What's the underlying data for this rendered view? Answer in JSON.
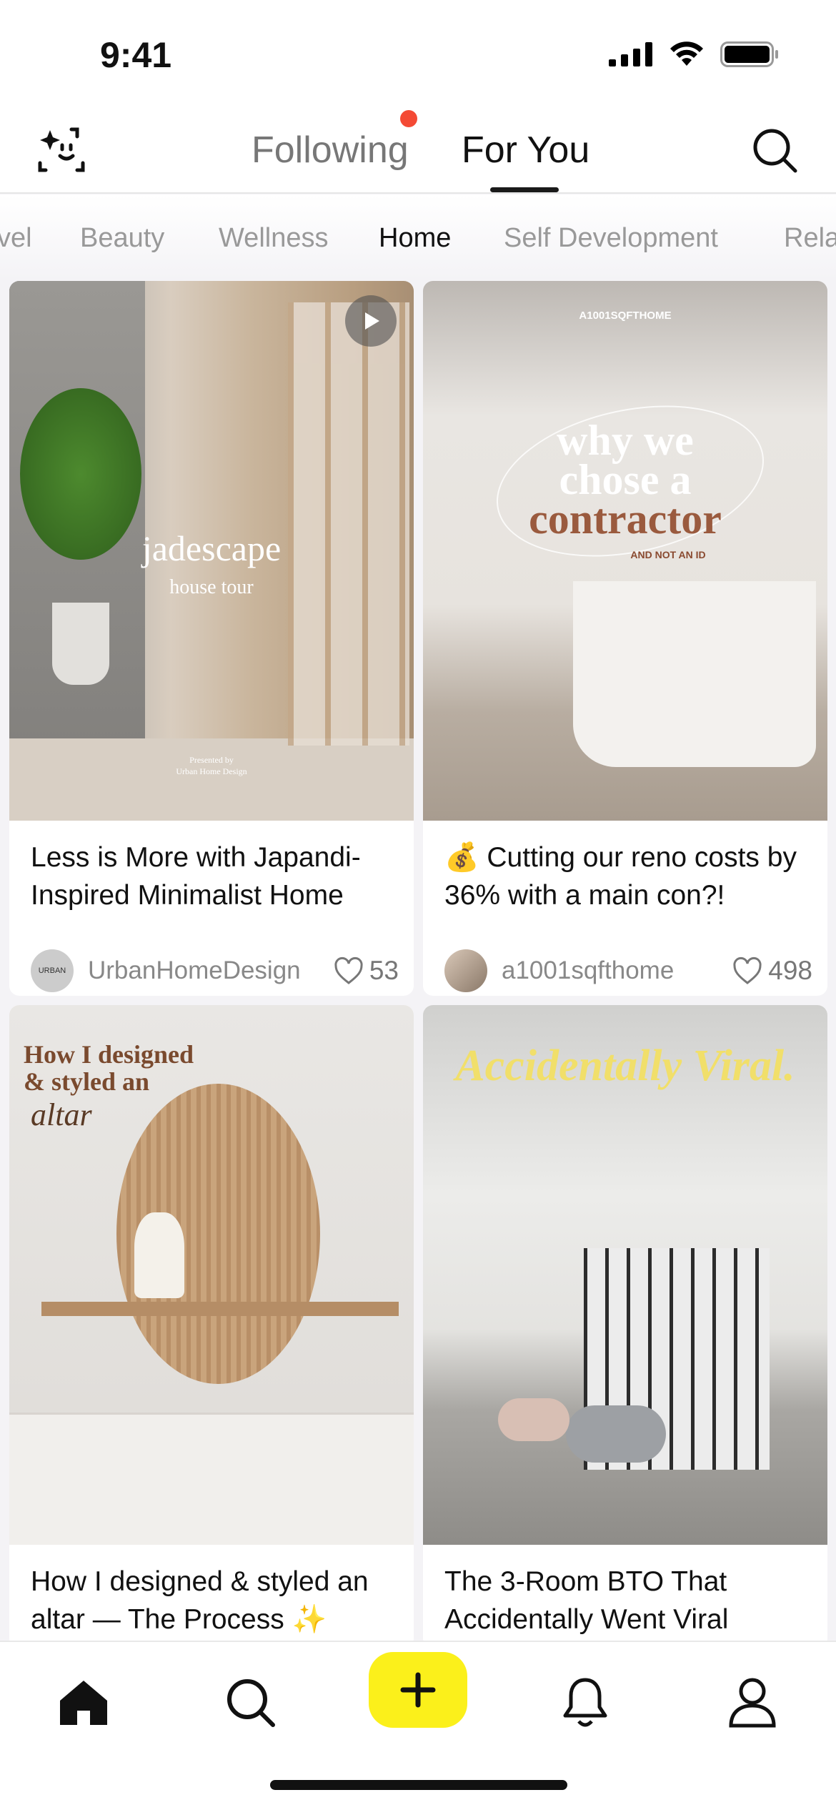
{
  "status_bar": {
    "time": "9:41"
  },
  "header": {
    "tabs": [
      {
        "label": "Following",
        "has_badge": true
      },
      {
        "label": "For You",
        "active": true
      }
    ],
    "left_icon": "face-sparkle-icon",
    "right_icon": "search-icon"
  },
  "categories": {
    "items": [
      "vel",
      "Beauty",
      "Wellness",
      "Home",
      "Self Development",
      "Rela"
    ],
    "active": "Home"
  },
  "feed": [
    {
      "title": "Less is More with Japandi-Inspired Minimalist Home",
      "author": "UrbanHomeDesign",
      "avatar_text": "URBAN",
      "likes": "53",
      "is_video": true,
      "overlay": {
        "headline": "jadescape",
        "sub": "house tour",
        "credit1": "Presented by",
        "credit2": "Urban Home Design"
      }
    },
    {
      "title": "💰 Cutting our reno costs by 36% with a main con?!",
      "author": "a1001sqfthome",
      "likes": "498",
      "overlay": {
        "brand": "A1001SQFTHOME",
        "line1": "why we",
        "line2": "chose a",
        "line3": "contractor",
        "sub": "AND NOT AN ID"
      }
    },
    {
      "title": "How I designed & styled an altar — The Process ✨",
      "overlay": {
        "line1": "How I designed",
        "line2": "& styled an",
        "line3": "altar"
      }
    },
    {
      "title": "The 3-Room BTO That Accidentally Went Viral",
      "overlay": {
        "line1": "Accidentally Viral."
      }
    }
  ],
  "bottom_nav": {
    "items": [
      "home-icon",
      "search-icon",
      "plus-icon",
      "bell-icon",
      "profile-icon"
    ],
    "accent": "#fbf01b"
  }
}
